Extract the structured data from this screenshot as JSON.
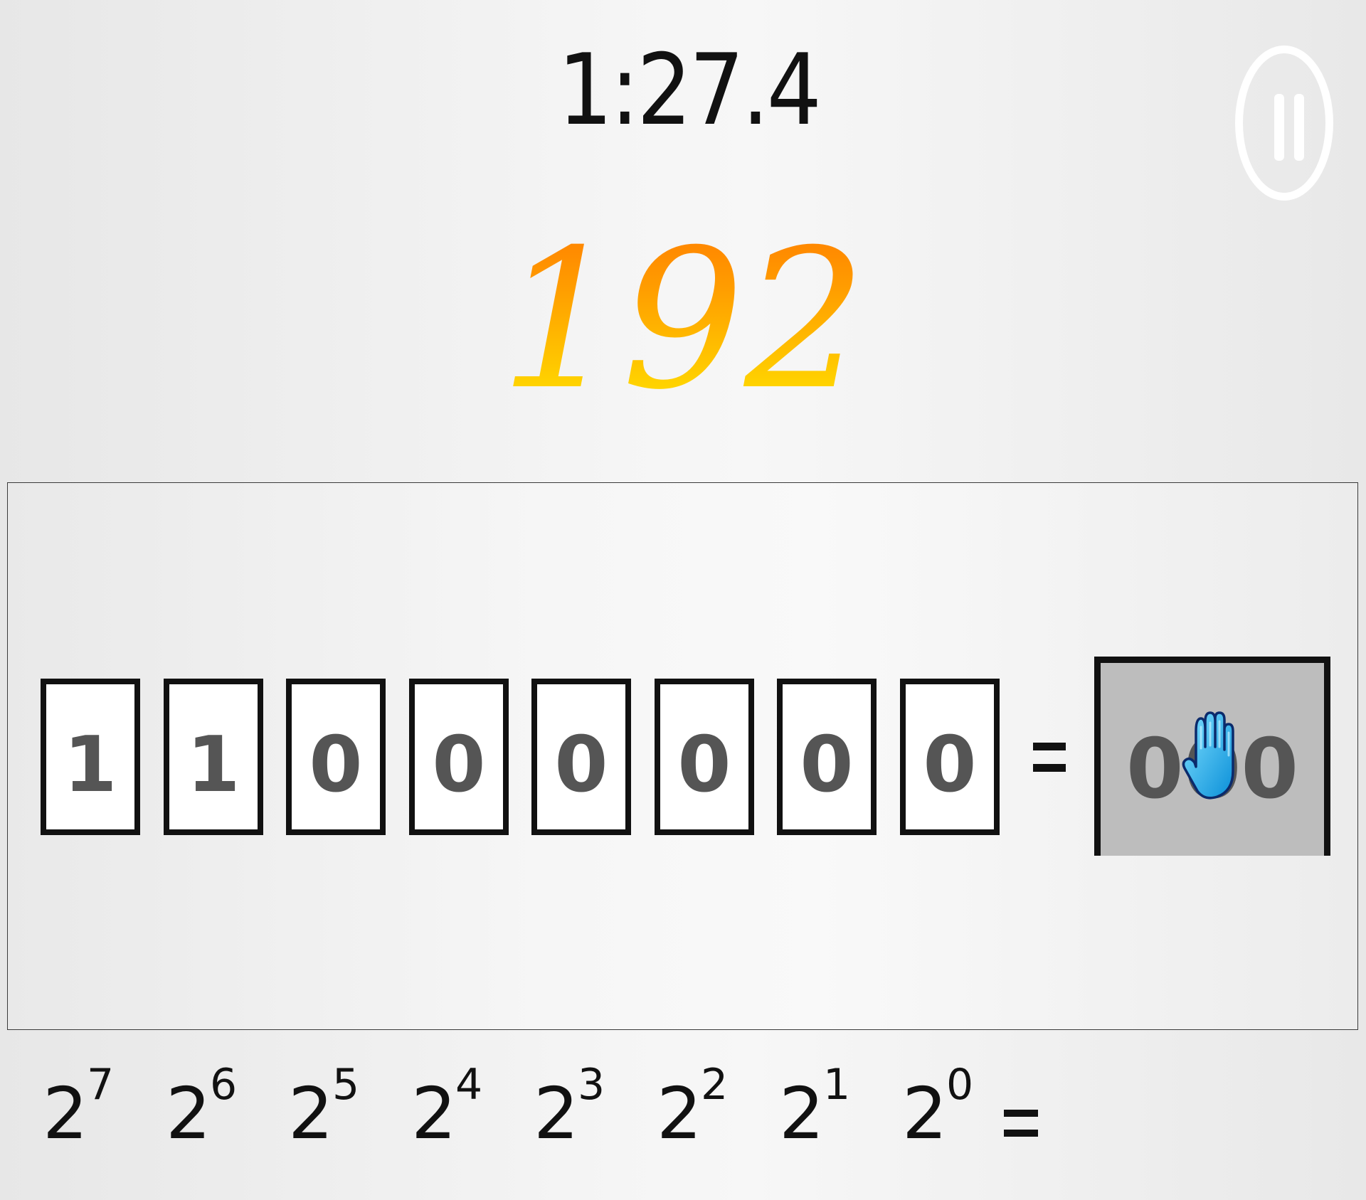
{
  "header": {
    "timer": "1:27.4",
    "target_number": "192",
    "pause_icon": "pause-icon"
  },
  "colors": {
    "target_gradient_top": "#ff7a00",
    "target_gradient_bottom": "#ffe000",
    "bit_text": "#555555",
    "answer_box_fill": "#bdbdbd",
    "hand_cursor": "#1aaee8"
  },
  "board": {
    "bits": [
      "1",
      "1",
      "0",
      "0",
      "0",
      "0",
      "0",
      "0"
    ],
    "equals": "=",
    "answer_value": "000",
    "cursor_icon": "hand-cursor-icon"
  },
  "powers": {
    "base": "2",
    "exponents": [
      "7",
      "6",
      "5",
      "4",
      "3",
      "2",
      "1",
      "0"
    ],
    "equals": "="
  }
}
